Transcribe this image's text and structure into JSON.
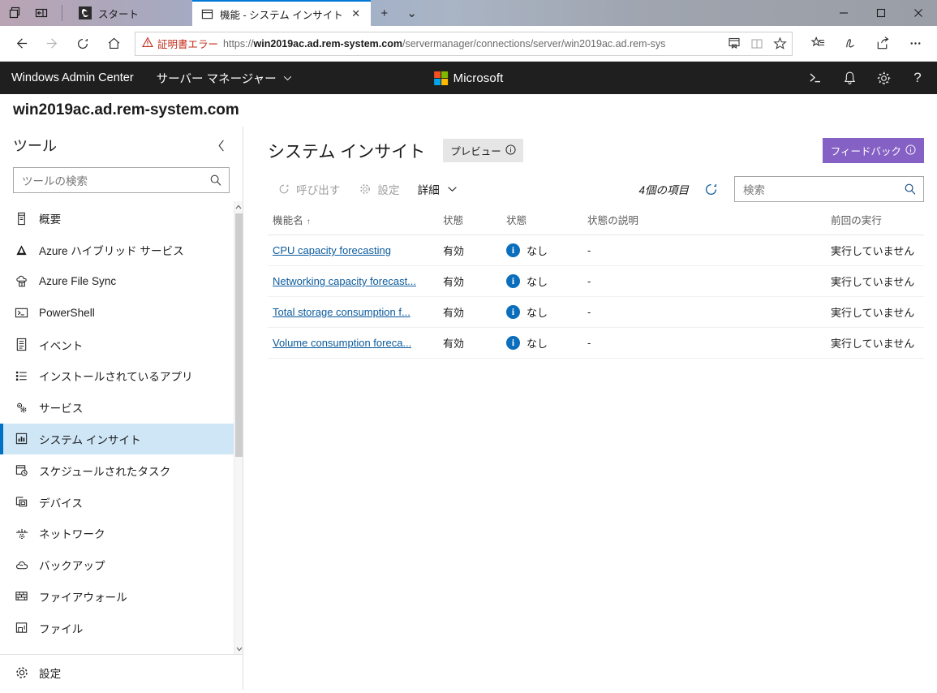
{
  "browser": {
    "sys_icons": [
      "tab-preview-icon",
      "split-screen-icon"
    ],
    "tabs": [
      {
        "title": "スタート",
        "favicon": "edge-start-icon",
        "active": false
      },
      {
        "title": "機能 - システム インサイト",
        "favicon": "window-icon",
        "active": true
      }
    ],
    "new_tab_label": "+",
    "tab_list_label": "⌄",
    "window_controls": {
      "minimize": "−",
      "maximize": "▫",
      "close": "✕"
    },
    "nav": {
      "back": "←",
      "forward": "→",
      "refresh": "↻",
      "home": "⌂"
    },
    "address": {
      "cert_warning": "証明書エラー",
      "url_scheme": "https://",
      "url_host": "win2019ac.ad.rem-system.com",
      "url_path": "/servermanager/connections/server/win2019ac.ad.rem-sys",
      "icons": [
        "reader-save-icon",
        "reading-view-icon",
        "favorite-star-icon"
      ]
    },
    "right_icons": [
      "collections-icon",
      "notes-pen-icon",
      "share-icon",
      "more-settings-icon"
    ]
  },
  "wac_header": {
    "brand": "Windows Admin Center",
    "section": "サーバー マネージャー",
    "section_caret": "⌄",
    "microsoft_label": "Microsoft",
    "ms_colors": [
      "#f25022",
      "#7fba00",
      "#00a4ef",
      "#ffb900"
    ],
    "icons": [
      "powershell-icon",
      "notification-bell-icon",
      "settings-gear-icon",
      "help-question-icon"
    ]
  },
  "server": {
    "name": "win2019ac.ad.rem-system.com"
  },
  "sidebar": {
    "title": "ツール",
    "collapse_icon": "chevron-left-icon",
    "search_placeholder": "ツールの検索",
    "search_icon": "search-icon",
    "items": [
      {
        "label": "概要",
        "icon": "overview-icon",
        "glyph": "▤",
        "selected": false
      },
      {
        "label": "Azure ハイブリッド サービス",
        "icon": "azure-icon",
        "glyph": "▲",
        "selected": false
      },
      {
        "label": "Azure File Sync",
        "icon": "cloud-sync-icon",
        "glyph": "☁",
        "selected": false
      },
      {
        "label": "PowerShell",
        "icon": "powershell-icon",
        "glyph": ">_",
        "selected": false
      },
      {
        "label": "イベント",
        "icon": "event-log-icon",
        "glyph": "▤",
        "selected": false
      },
      {
        "label": "インストールされているアプリ",
        "icon": "app-list-icon",
        "glyph": "☰",
        "selected": false
      },
      {
        "label": "サービス",
        "icon": "services-gear-icon",
        "glyph": "⚙",
        "selected": false
      },
      {
        "label": "システム インサイト",
        "icon": "system-insights-icon",
        "glyph": "▥",
        "selected": true
      },
      {
        "label": "スケジュールされたタスク",
        "icon": "scheduled-task-icon",
        "glyph": "▦",
        "selected": false
      },
      {
        "label": "デバイス",
        "icon": "devices-icon",
        "glyph": "▣",
        "selected": false
      },
      {
        "label": "ネットワーク",
        "icon": "network-icon",
        "glyph": "⎯",
        "selected": false
      },
      {
        "label": "バックアップ",
        "icon": "backup-cloud-icon",
        "glyph": "☁",
        "selected": false
      },
      {
        "label": "ファイアウォール",
        "icon": "firewall-icon",
        "glyph": "▩",
        "selected": false
      },
      {
        "label": "ファイル",
        "icon": "files-folder-icon",
        "glyph": "🗀",
        "selected": false
      }
    ],
    "footer": {
      "label": "設定",
      "icon": "settings-gear-icon"
    },
    "scrollbar": {
      "up_arrow": "⌃",
      "down_arrow": "⌄"
    }
  },
  "main": {
    "title": "システム インサイト",
    "preview_badge": "プレビュー",
    "preview_info_icon": "info-circle-icon",
    "feedback_button": "フィードバック",
    "feedback_info_icon": "info-circle-icon",
    "toolbar": {
      "invoke_label": "呼び出す",
      "invoke_icon": "refresh-circular-icon",
      "settings_label": "設定",
      "settings_icon": "gear-icon",
      "details_label": "詳細",
      "details_caret": "⌄",
      "item_count": "4個の項目",
      "refresh_icon": "refresh-icon",
      "search_placeholder": "検索",
      "search_icon": "search-icon"
    },
    "table": {
      "columns": [
        {
          "header": "機能名",
          "sort": "↑"
        },
        {
          "header": "状態",
          "sort": ""
        },
        {
          "header": "状態",
          "sort": ""
        },
        {
          "header": "状態の説明",
          "sort": ""
        },
        {
          "header": "前回の実行",
          "sort": ""
        }
      ],
      "rows": [
        {
          "name": "CPU capacity forecasting",
          "enabled": "有効",
          "status": "なし",
          "status_icon": "info-circle-icon",
          "description": "-",
          "last_run": "実行していません"
        },
        {
          "name": "Networking capacity forecast...",
          "enabled": "有効",
          "status": "なし",
          "status_icon": "info-circle-icon",
          "description": "-",
          "last_run": "実行していません"
        },
        {
          "name": "Total storage consumption f...",
          "enabled": "有効",
          "status": "なし",
          "status_icon": "info-circle-icon",
          "description": "-",
          "last_run": "実行していません"
        },
        {
          "name": "Volume consumption foreca...",
          "enabled": "有効",
          "status": "なし",
          "status_icon": "info-circle-icon",
          "description": "-",
          "last_run": "実行していません"
        }
      ]
    }
  },
  "colors": {
    "accent_blue": "#0072c6",
    "link_blue": "#0a5a9c",
    "selected_row": "#cfe6f7",
    "feedback_purple": "#8661c5",
    "cert_error_red": "#c42b1c",
    "topbar_dark": "#1f1f1f"
  }
}
